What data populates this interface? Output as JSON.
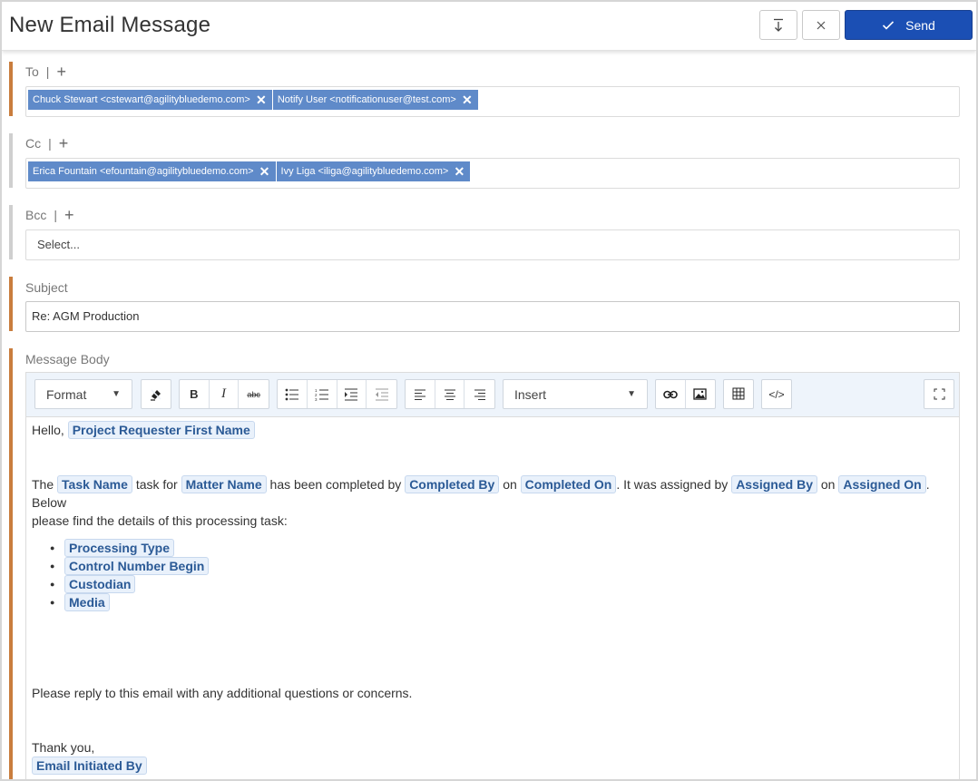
{
  "title": "New Email Message",
  "header": {
    "send_label": "Send"
  },
  "to": {
    "label": "To",
    "recipients": [
      "Chuck Stewart <cstewart@agilitybluedemo.com>",
      "Notify User <notificationuser@test.com>"
    ]
  },
  "cc": {
    "label": "Cc",
    "recipients": [
      "Erica Fountain <efountain@agilitybluedemo.com>",
      "Ivy Liga <iliga@agilitybluedemo.com>"
    ]
  },
  "bcc": {
    "label": "Bcc",
    "placeholder": "Select..."
  },
  "subject": {
    "label": "Subject",
    "value": "Re: AGM Production"
  },
  "message": {
    "label": "Message Body",
    "toolbar": {
      "format": "Format",
      "insert": "Insert"
    },
    "greeting": "Hello,",
    "requester_tag": "Project Requester First Name",
    "line1": {
      "t1": "The",
      "task_name": "Task Name",
      "t2": "task for",
      "matter_name": "Matter Name",
      "t3": "has been completed by",
      "completed_by": "Completed By",
      "t4": "on",
      "completed_on": "Completed On",
      "t5": ". It was assigned by",
      "assigned_by": "Assigned By",
      "t6": "on",
      "assigned_on": "Assigned On",
      "t7": ". Below",
      "t8": "please find the details of this processing task:"
    },
    "list": [
      "Processing Type",
      "Control Number Begin",
      "Custodian",
      "Media"
    ],
    "reply": "Please reply to this email with any additional questions or concerns.",
    "thanks": "Thank you,",
    "initiated_by": "Email Initiated By"
  },
  "colors": {
    "accent": "#1b4fb4",
    "chip": "#5f8ac9",
    "required_bar": "#c97d3d",
    "tag_text": "#2b5a96"
  }
}
